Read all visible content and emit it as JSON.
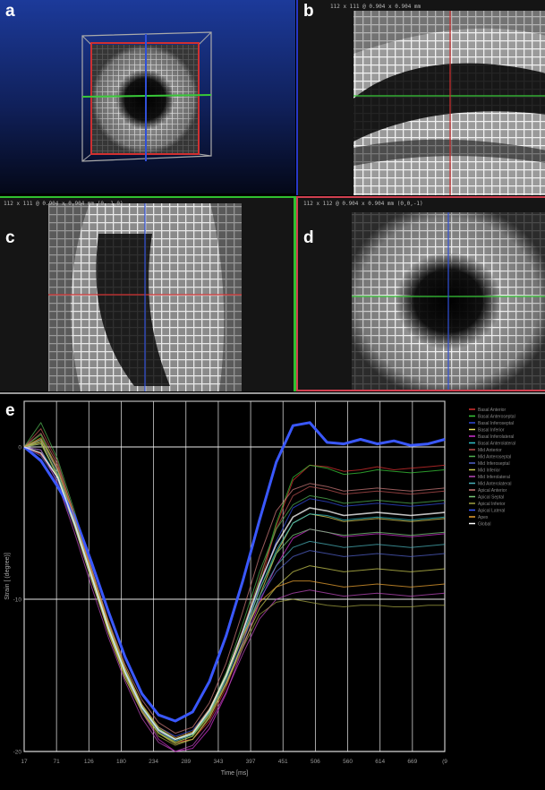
{
  "panels": {
    "a": {
      "label": "a",
      "info": ""
    },
    "b": {
      "label": "b",
      "info": "112 x 111 @ 0.904 x 0.904 mm"
    },
    "c": {
      "label": "c",
      "info": "112 x 111 @ 0.904 x 0.904 mm   (0,-1,0)"
    },
    "d": {
      "label": "d",
      "info": "112 x 112 @ 0.904 x 0.904 mm   (0,0,-1)"
    },
    "e": {
      "label": "e"
    }
  },
  "colors": {
    "crosshair_red": "#d03030",
    "crosshair_green": "#38c838",
    "crosshair_blue": "#3050d8",
    "border_b": "#2838c8",
    "border_c": "#30c030",
    "border_d": "#d04050",
    "border_e": "#9a9a9a"
  },
  "chart_data": {
    "type": "line",
    "title": "",
    "xlabel": "Time [ms]",
    "ylabel": "Strain [ (degree)]",
    "x_tick_labels": [
      "17",
      "71",
      "126",
      "180",
      "234",
      "289",
      "343",
      "397",
      "451",
      "506",
      "560",
      "614",
      "669",
      "(9"
    ],
    "y_tick_labels": [
      "0",
      "-10",
      "-20"
    ],
    "ylim": [
      -20,
      3
    ],
    "grid": true,
    "legend_position": "right",
    "x": [
      17,
      44,
      71,
      98,
      126,
      153,
      180,
      207,
      234,
      261,
      289,
      316,
      343,
      370,
      397,
      424,
      451,
      478,
      506,
      533,
      560,
      587,
      614,
      641,
      669,
      696
    ],
    "series": [
      {
        "name": "Basal Anterior",
        "color": "#d83030",
        "values": [
          0,
          -0.5,
          -2,
          -4.5,
          -8,
          -11.5,
          -14.5,
          -17,
          -18.6,
          -19.4,
          -19.2,
          -18,
          -15.8,
          -12.8,
          -9.2,
          -5.2,
          -2.2,
          -1.2,
          -1.3,
          -1.6,
          -1.5,
          -1.3,
          -1.5,
          -1.4,
          -1.3,
          -1.2
        ]
      },
      {
        "name": "Basal Anteroseptal",
        "color": "#38c838",
        "values": [
          0,
          0.8,
          -1.5,
          -4.8,
          -8.5,
          -12,
          -15,
          -17.2,
          -18.7,
          -19.4,
          -19,
          -17.5,
          -15.2,
          -12.2,
          -8.8,
          -5,
          -2,
          -1.2,
          -1.4,
          -1.8,
          -1.7,
          -1.5,
          -1.6,
          -1.7,
          -1.6,
          -1.5
        ]
      },
      {
        "name": "Basal Inferoseptal",
        "color": "#3048d8",
        "values": [
          0,
          -1,
          -2.5,
          -5.2,
          -8.8,
          -12,
          -14.8,
          -17,
          -18.4,
          -19,
          -18.6,
          -17.2,
          -15,
          -12.3,
          -9.2,
          -6.2,
          -4,
          -3.4,
          -3.6,
          -3.9,
          -3.8,
          -3.7,
          -3.8,
          -3.9,
          -3.8,
          -3.7
        ]
      },
      {
        "name": "Basal Inferior",
        "color": "#e8e060",
        "values": [
          0,
          0.3,
          -1.8,
          -5,
          -8.6,
          -12.2,
          -15.2,
          -17.4,
          -18.8,
          -19.5,
          -19.2,
          -17.8,
          -15.6,
          -12.8,
          -9.8,
          -7,
          -5,
          -4.4,
          -4.6,
          -4.9,
          -4.8,
          -4.7,
          -4.8,
          -4.9,
          -4.8,
          -4.7
        ]
      },
      {
        "name": "Basal Inferolateral",
        "color": "#d030d0",
        "values": [
          0,
          0.5,
          -1.5,
          -4.8,
          -8.4,
          -11.8,
          -14.8,
          -17.4,
          -19.2,
          -20,
          -19.8,
          -18.5,
          -16.2,
          -13.2,
          -10.2,
          -7.8,
          -6,
          -5.4,
          -5.6,
          -5.9,
          -5.8,
          -5.7,
          -5.8,
          -5.9,
          -5.8,
          -5.7
        ]
      },
      {
        "name": "Basal Anterolateral",
        "color": "#30c0c8",
        "values": [
          0,
          -0.2,
          -2,
          -5,
          -8.5,
          -11.8,
          -14.7,
          -17,
          -18.5,
          -19.2,
          -18.8,
          -17.4,
          -15.2,
          -12.4,
          -9.4,
          -6.8,
          -5,
          -4.4,
          -4.5,
          -4.8,
          -4.7,
          -4.6,
          -4.7,
          -4.8,
          -4.7,
          -4.6
        ]
      },
      {
        "name": "Mid Anterior",
        "color": "#b85050",
        "values": [
          0,
          1.2,
          -1,
          -4.5,
          -8.2,
          -11.6,
          -14.6,
          -16.9,
          -18.5,
          -19.2,
          -18.9,
          -17.4,
          -15,
          -12,
          -8.6,
          -5.4,
          -3.2,
          -2.6,
          -2.8,
          -3.1,
          -3,
          -2.9,
          -3,
          -3.1,
          -3,
          -2.9
        ]
      },
      {
        "name": "Mid Anteroseptal",
        "color": "#50b050",
        "values": [
          0,
          1.6,
          -0.8,
          -4.2,
          -8,
          -11.5,
          -14.5,
          -16.9,
          -18.5,
          -19.2,
          -18.8,
          -17.3,
          -14.8,
          -11.6,
          -8.2,
          -5.4,
          -3.8,
          -3.2,
          -3.4,
          -3.7,
          -3.6,
          -3.5,
          -3.6,
          -3.7,
          -3.6,
          -3.5
        ]
      },
      {
        "name": "Mid Inferoseptal",
        "color": "#5060c8",
        "values": [
          0,
          -0.6,
          -2.2,
          -5.2,
          -8.8,
          -12,
          -14.9,
          -17.2,
          -18.7,
          -19.3,
          -18.9,
          -17.5,
          -15.4,
          -12.8,
          -10,
          -8.2,
          -7.2,
          -6.8,
          -7,
          -7.2,
          -7.1,
          -7,
          -7.1,
          -7.2,
          -7.1,
          -7
        ]
      },
      {
        "name": "Mid Inferior",
        "color": "#c8c850",
        "values": [
          0,
          0.4,
          -2,
          -5.2,
          -8.8,
          -12.1,
          -15,
          -17.3,
          -18.8,
          -19.4,
          -19,
          -17.6,
          -15.5,
          -13,
          -10.6,
          -9.2,
          -8.2,
          -7.8,
          -8,
          -8.2,
          -8.1,
          -8,
          -8.1,
          -8.2,
          -8.1,
          -8
        ]
      },
      {
        "name": "Mid Inferolateral",
        "color": "#b848b8",
        "values": [
          0,
          -0.2,
          -2.4,
          -5.6,
          -9.2,
          -12.5,
          -15.4,
          -17.8,
          -19.4,
          -20,
          -19.6,
          -18.2,
          -16.1,
          -13.6,
          -11.3,
          -10,
          -9.6,
          -9.4,
          -9.6,
          -9.8,
          -9.7,
          -9.6,
          -9.7,
          -9.8,
          -9.7,
          -9.6
        ]
      },
      {
        "name": "Mid Anterolateral",
        "color": "#48b0b8",
        "values": [
          0,
          0.2,
          -1.8,
          -4.9,
          -8.5,
          -11.9,
          -14.8,
          -17.1,
          -18.6,
          -19.3,
          -18.9,
          -17.4,
          -15.2,
          -12.5,
          -9.8,
          -7.8,
          -6.6,
          -6.2,
          -6.4,
          -6.6,
          -6.5,
          -6.4,
          -6.5,
          -6.6,
          -6.5,
          -6.4
        ]
      },
      {
        "name": "Apical Anterior",
        "color": "#c87878",
        "values": [
          0,
          0.9,
          -1.2,
          -4.4,
          -8,
          -11.4,
          -14.3,
          -16.6,
          -18.1,
          -18.8,
          -18.4,
          -16.8,
          -14.2,
          -10.8,
          -7.2,
          -4.2,
          -2.8,
          -2.4,
          -2.6,
          -2.9,
          -2.8,
          -2.7,
          -2.8,
          -2.9,
          -2.8,
          -2.7
        ]
      },
      {
        "name": "Apical Septal",
        "color": "#78c878",
        "values": [
          0,
          0.5,
          -1.6,
          -4.7,
          -8.3,
          -11.7,
          -14.6,
          -17,
          -18.5,
          -19.2,
          -18.9,
          -17.5,
          -15.2,
          -12.4,
          -9.4,
          -7,
          -5.8,
          -5.4,
          -5.6,
          -5.8,
          -5.7,
          -5.6,
          -5.7,
          -5.8,
          -5.7,
          -5.6
        ]
      },
      {
        "name": "Apical Inferior",
        "color": "#a0a040",
        "values": [
          0,
          0.2,
          -1.9,
          -5.1,
          -8.7,
          -12,
          -15,
          -17.4,
          -19,
          -19.6,
          -19.2,
          -17.7,
          -15.6,
          -13.2,
          -11,
          -10.2,
          -10,
          -10.2,
          -10.4,
          -10.5,
          -10.4,
          -10.4,
          -10.5,
          -10.5,
          -10.4,
          -10.4
        ]
      },
      {
        "name": "Apical Lateral",
        "color": "#3a58ff",
        "values": [
          0,
          -0.9,
          -2.6,
          -4.5,
          -7.6,
          -10.8,
          -13.8,
          -16.2,
          -17.6,
          -18,
          -17.4,
          -15.4,
          -12.4,
          -8.8,
          -4.8,
          -1,
          1.4,
          1.6,
          0.3,
          0.2,
          0.5,
          0.2,
          0.4,
          0.1,
          0.2,
          0.5
        ]
      },
      {
        "name": "Apex",
        "color": "#e8a030",
        "values": [
          0,
          0.6,
          -1.4,
          -4.6,
          -8.2,
          -11.6,
          -14.5,
          -16.9,
          -18.4,
          -19.1,
          -18.7,
          -17.2,
          -15,
          -12.4,
          -10.2,
          -9.2,
          -8.8,
          -8.8,
          -9,
          -9.2,
          -9.1,
          -9,
          -9.1,
          -9.2,
          -9.1,
          -9
        ]
      },
      {
        "name": "Global",
        "color": "#ffffff",
        "values": [
          0,
          -0.4,
          -2,
          -5,
          -8.5,
          -11.9,
          -14.8,
          -17.1,
          -18.6,
          -19.2,
          -18.8,
          -17.3,
          -15,
          -12.1,
          -9,
          -6.4,
          -4.6,
          -4,
          -4.2,
          -4.5,
          -4.4,
          -4.3,
          -4.4,
          -4.5,
          -4.4,
          -4.3
        ]
      }
    ]
  }
}
